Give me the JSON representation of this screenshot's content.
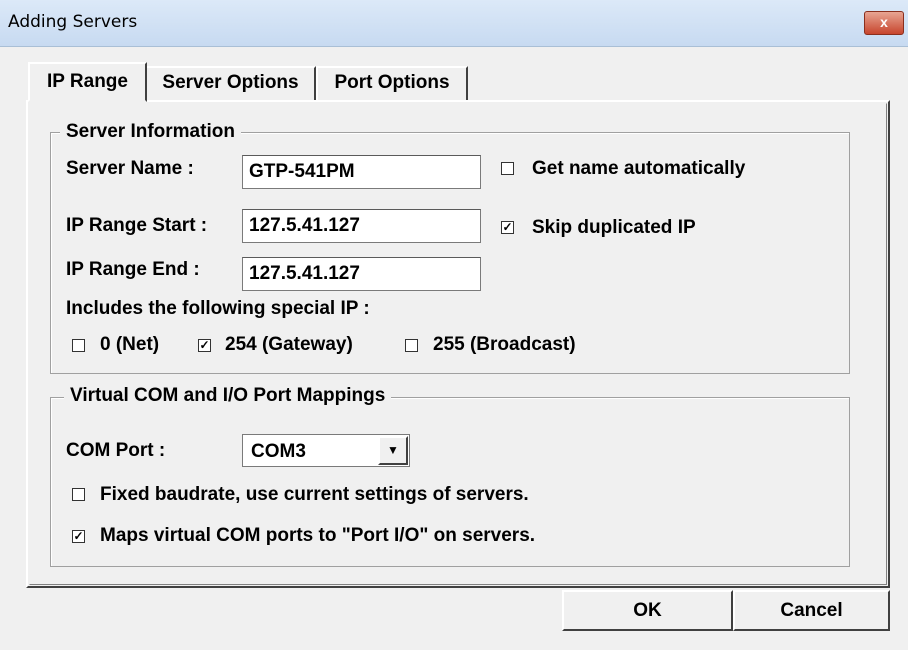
{
  "window": {
    "title": "Adding Servers",
    "close_glyph": "x"
  },
  "tabs": [
    {
      "label": "IP Range",
      "active": true
    },
    {
      "label": "Server Options",
      "active": false
    },
    {
      "label": "Port Options",
      "active": false
    }
  ],
  "server_info": {
    "legend": "Server Information",
    "server_name_label": "Server Name :",
    "server_name_value": "GTP-541PM",
    "ip_start_label": "IP Range Start :",
    "ip_start_value": "127.5.41.127",
    "ip_end_label": "IP Range End :",
    "ip_end_value": "127.5.41.127",
    "get_name_label": "Get name automatically",
    "get_name_checked": false,
    "skip_dup_label": "Skip duplicated IP",
    "skip_dup_checked": true,
    "special_ip_label": "Includes the following special IP :",
    "special": [
      {
        "label": "0 (Net)",
        "checked": false
      },
      {
        "label": "254 (Gateway)",
        "checked": true
      },
      {
        "label": "255 (Broadcast)",
        "checked": false
      }
    ]
  },
  "virtual_com": {
    "legend": "Virtual COM and I/O Port Mappings",
    "com_port_label": "COM Port :",
    "com_port_value": "COM3",
    "fixed_baud_label": "Fixed baudrate, use current settings of servers.",
    "fixed_baud_checked": false,
    "maps_label": "Maps virtual COM ports to \"Port I/O\" on servers.",
    "maps_checked": true
  },
  "buttons": {
    "ok": "OK",
    "cancel": "Cancel"
  },
  "icons": {
    "check": "✓",
    "dropdown": "▼"
  }
}
